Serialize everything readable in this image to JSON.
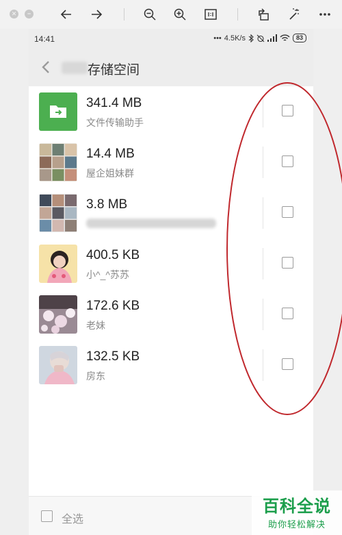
{
  "status_bar": {
    "time": "14:41",
    "dots": "•••",
    "speed": "4.5K/s",
    "battery": "83"
  },
  "header": {
    "title": "存储空间"
  },
  "rows": [
    {
      "size": "341.4 MB",
      "name": "文件传输助手",
      "thumb": "folder-green",
      "accent": "#4caf50"
    },
    {
      "size": "14.4 MB",
      "name": "屋企姐妹群",
      "thumb": "group-collage"
    },
    {
      "size": "3.8 MB",
      "name": "",
      "thumb": "group-collage"
    },
    {
      "size": "400.5 KB",
      "name": "小^_^苏苏",
      "thumb": "child-photo"
    },
    {
      "size": "172.6 KB",
      "name": "老妹",
      "thumb": "flower-photo"
    },
    {
      "size": "132.5 KB",
      "name": "房东",
      "thumb": "selfie-photo"
    }
  ],
  "bottom_bar": {
    "select_all_label": "全选"
  },
  "watermark": {
    "line1": "百科全说",
    "line2": "助你轻松解决"
  },
  "colors": {
    "annotation": "#c0282d",
    "brand_green": "#1b9e4b"
  }
}
